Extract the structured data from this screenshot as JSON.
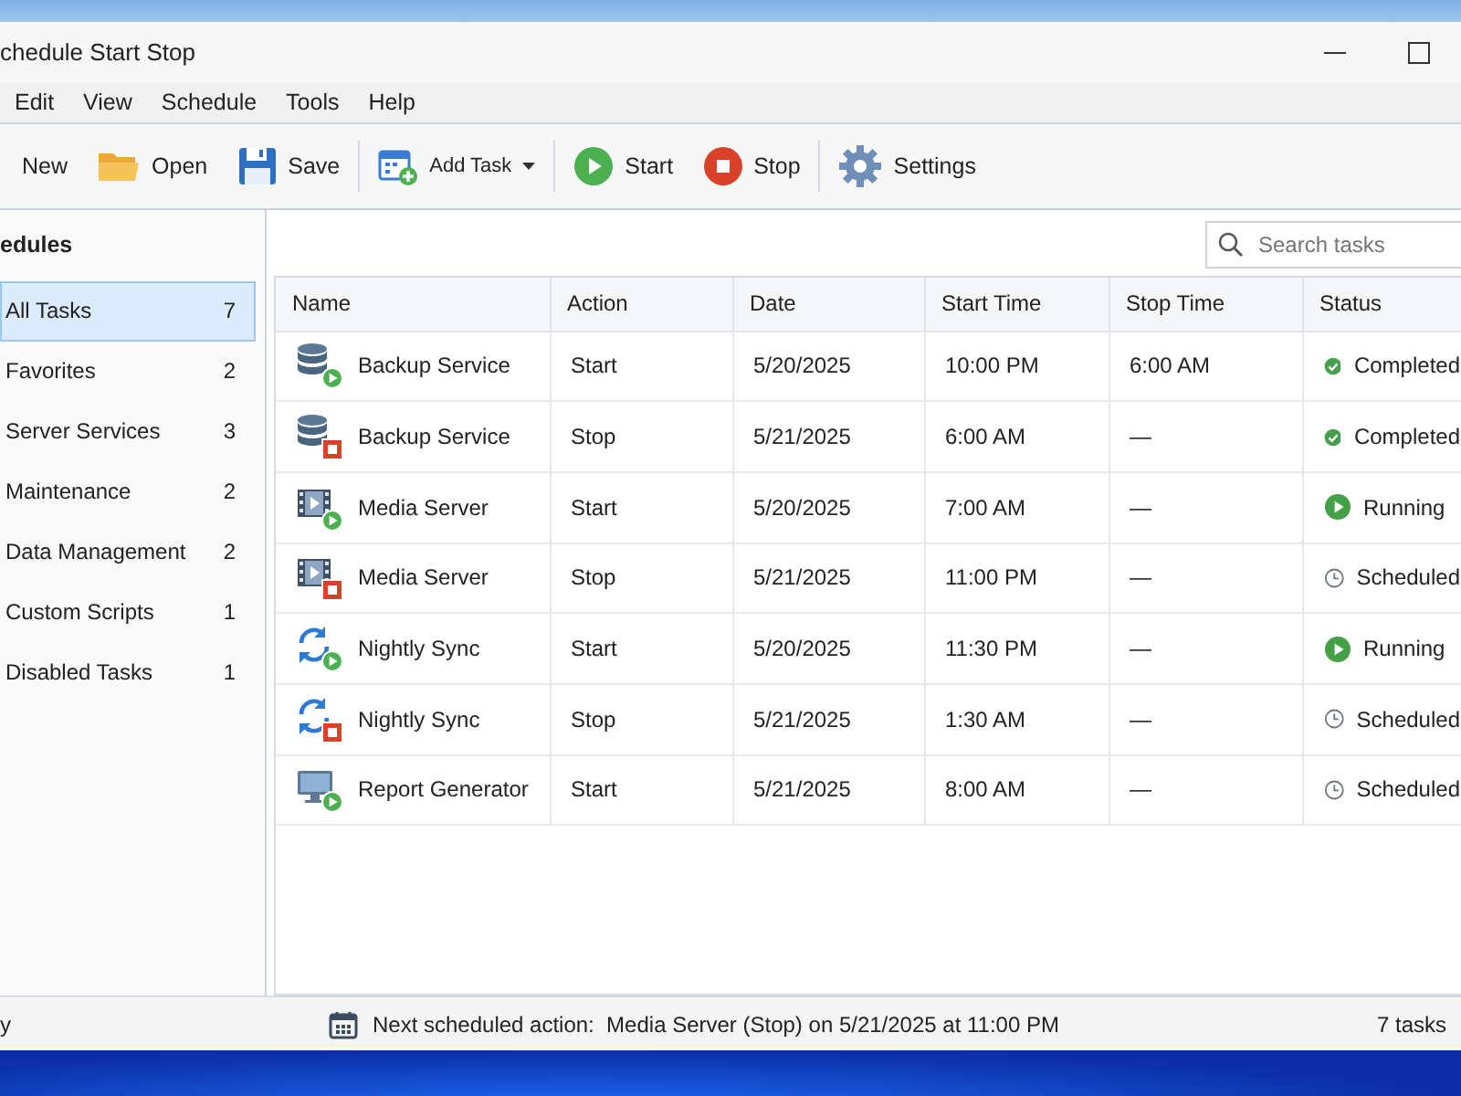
{
  "window": {
    "title": "chedule Start Stop"
  },
  "menu": [
    "Edit",
    "View",
    "Schedule",
    "Tools",
    "Help"
  ],
  "toolbar": [
    {
      "kind": "new",
      "label": "New"
    },
    {
      "kind": "open",
      "label": "Open"
    },
    {
      "kind": "save",
      "label": "Save"
    },
    {
      "kind": "add",
      "label": "Add Task",
      "dropdown": true
    },
    {
      "kind": "start",
      "label": "Start"
    },
    {
      "kind": "stop",
      "label": "Stop"
    },
    {
      "kind": "settings",
      "label": "Settings"
    }
  ],
  "sidebar": {
    "title": "edules",
    "items": [
      {
        "label": "All Tasks",
        "count": "7",
        "selected": true
      },
      {
        "label": "Favorites",
        "count": "2",
        "selected": false
      },
      {
        "label": "Server Services",
        "count": "3",
        "selected": false
      },
      {
        "label": "Maintenance",
        "count": "2",
        "selected": false
      },
      {
        "label": "Data Management",
        "count": "2",
        "selected": false
      },
      {
        "label": "Custom Scripts",
        "count": "1",
        "selected": false
      },
      {
        "label": "Disabled Tasks",
        "count": "1",
        "selected": false
      }
    ]
  },
  "search": {
    "placeholder": "Search tasks"
  },
  "table": {
    "columns": [
      "Name",
      "Action",
      "Date",
      "Start Time",
      "Stop Time",
      "Status"
    ],
    "rows": [
      {
        "kind": "database-start",
        "name": "Backup Service",
        "action": "Start",
        "date": "5/20/2025",
        "start_time": "10:00 PM",
        "stop_time": "6:00 AM",
        "status": {
          "kind": "completed",
          "label": "Completed"
        }
      },
      {
        "kind": "database-stop",
        "name": "Backup Service",
        "action": "Stop",
        "date": "5/21/2025",
        "start_time": "6:00 AM",
        "stop_time": "—",
        "status": {
          "kind": "completed",
          "label": "Completed"
        }
      },
      {
        "kind": "film-start",
        "name": "Media Server",
        "action": "Start",
        "date": "5/20/2025",
        "start_time": "7:00 AM",
        "stop_time": "—",
        "status": {
          "kind": "running",
          "label": "Running"
        }
      },
      {
        "kind": "film-stop",
        "name": "Media Server",
        "action": "Stop",
        "date": "5/21/2025",
        "start_time": "11:00 PM",
        "stop_time": "—",
        "status": {
          "kind": "scheduled",
          "label": "Scheduled"
        }
      },
      {
        "kind": "sync-start",
        "name": "Nightly Sync",
        "action": "Start",
        "date": "5/20/2025",
        "start_time": "11:30 PM",
        "stop_time": "—",
        "status": {
          "kind": "running",
          "label": "Running"
        }
      },
      {
        "kind": "sync-stop",
        "name": "Nightly Sync",
        "action": "Stop",
        "date": "5/21/2025",
        "start_time": "1:30 AM",
        "stop_time": "—",
        "status": {
          "kind": "scheduled",
          "label": "Scheduled"
        }
      },
      {
        "kind": "monitor-start",
        "name": "Report Generator",
        "action": "Start",
        "date": "5/21/2025",
        "start_time": "8:00 AM",
        "stop_time": "—",
        "status": {
          "kind": "scheduled",
          "label": "Scheduled"
        }
      }
    ]
  },
  "status_bar": {
    "left": "y",
    "message": "Next scheduled action:  Media Server (Stop) on 5/21/2025 at 11:00 PM",
    "count": "7 tasks"
  }
}
